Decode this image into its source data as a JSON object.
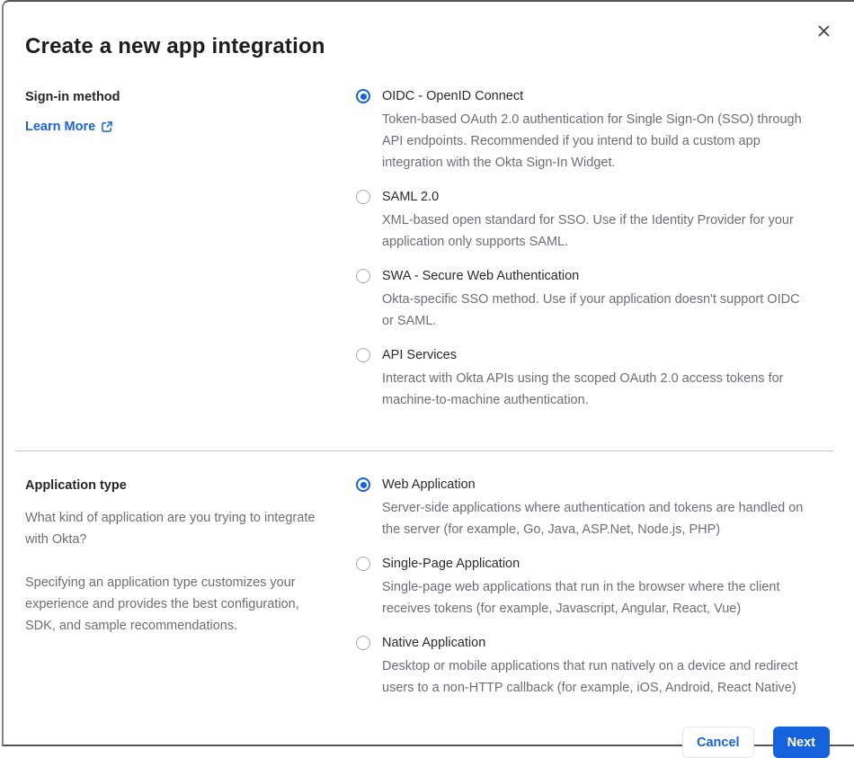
{
  "dialog": {
    "title": "Create a new app integration"
  },
  "sign_in": {
    "label": "Sign-in method",
    "learn_more_label": "Learn More",
    "options": [
      {
        "label": "OIDC - OpenID Connect",
        "desc": "Token-based OAuth 2.0 authentication for Single Sign-On (SSO) through API endpoints. Recommended if you intend to build a custom app integration with the Okta Sign-In Widget.",
        "selected": true
      },
      {
        "label": "SAML 2.0",
        "desc": "XML-based open standard for SSO. Use if the Identity Provider for your application only supports SAML.",
        "selected": false
      },
      {
        "label": "SWA - Secure Web Authentication",
        "desc": "Okta-specific SSO method. Use if your application doesn't support OIDC or SAML.",
        "selected": false
      },
      {
        "label": "API Services",
        "desc": "Interact with Okta APIs using the scoped OAuth 2.0 access tokens for machine-to-machine authentication.",
        "selected": false
      }
    ]
  },
  "application_type": {
    "label": "Application type",
    "intro": "What kind of application are you trying to integrate with Okta?",
    "note": "Specifying an application type customizes your experience and provides the best configuration, SDK, and sample recommendations.",
    "options": [
      {
        "label": "Web Application",
        "desc": "Server-side applications where authentication and tokens are handled on the server (for example, Go, Java, ASP.Net, Node.js, PHP)",
        "selected": true
      },
      {
        "label": "Single-Page Application",
        "desc": "Single-page web applications that run in the browser where the client receives tokens (for example, Javascript, Angular, React, Vue)",
        "selected": false
      },
      {
        "label": "Native Application",
        "desc": "Desktop or mobile applications that run natively on a device and redirect users to a non-HTTP callback (for example, iOS, Android, React Native)",
        "selected": false
      }
    ]
  },
  "footer": {
    "cancel_label": "Cancel",
    "next_label": "Next"
  },
  "colors": {
    "accent_blue": "#1662dd",
    "title_text": "#1d1d21",
    "body_text": "#6e6e78",
    "divider": "#c4c4c9"
  }
}
